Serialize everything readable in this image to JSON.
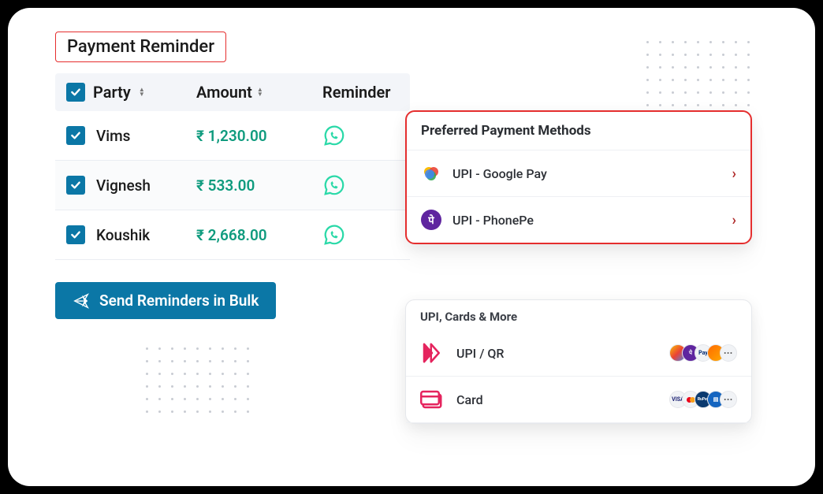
{
  "title": "Payment Reminder",
  "table": {
    "headers": {
      "party": "Party",
      "amount": "Amount",
      "reminder": "Reminder"
    },
    "rows": [
      {
        "name": "Vims",
        "amount": "₹ 1,230.00"
      },
      {
        "name": "Vignesh",
        "amount": "₹ 533.00"
      },
      {
        "name": "Koushik",
        "amount": "₹ 2,668.00"
      }
    ]
  },
  "bulk_button": "Send Reminders in Bulk",
  "preferred": {
    "title": "Preferred Payment Methods",
    "items": [
      {
        "label": "UPI - Google Pay"
      },
      {
        "label": "UPI - PhonePe"
      }
    ]
  },
  "more": {
    "title": "UPI, Cards & More",
    "items": [
      {
        "label": "UPI / QR"
      },
      {
        "label": "Card"
      }
    ]
  }
}
